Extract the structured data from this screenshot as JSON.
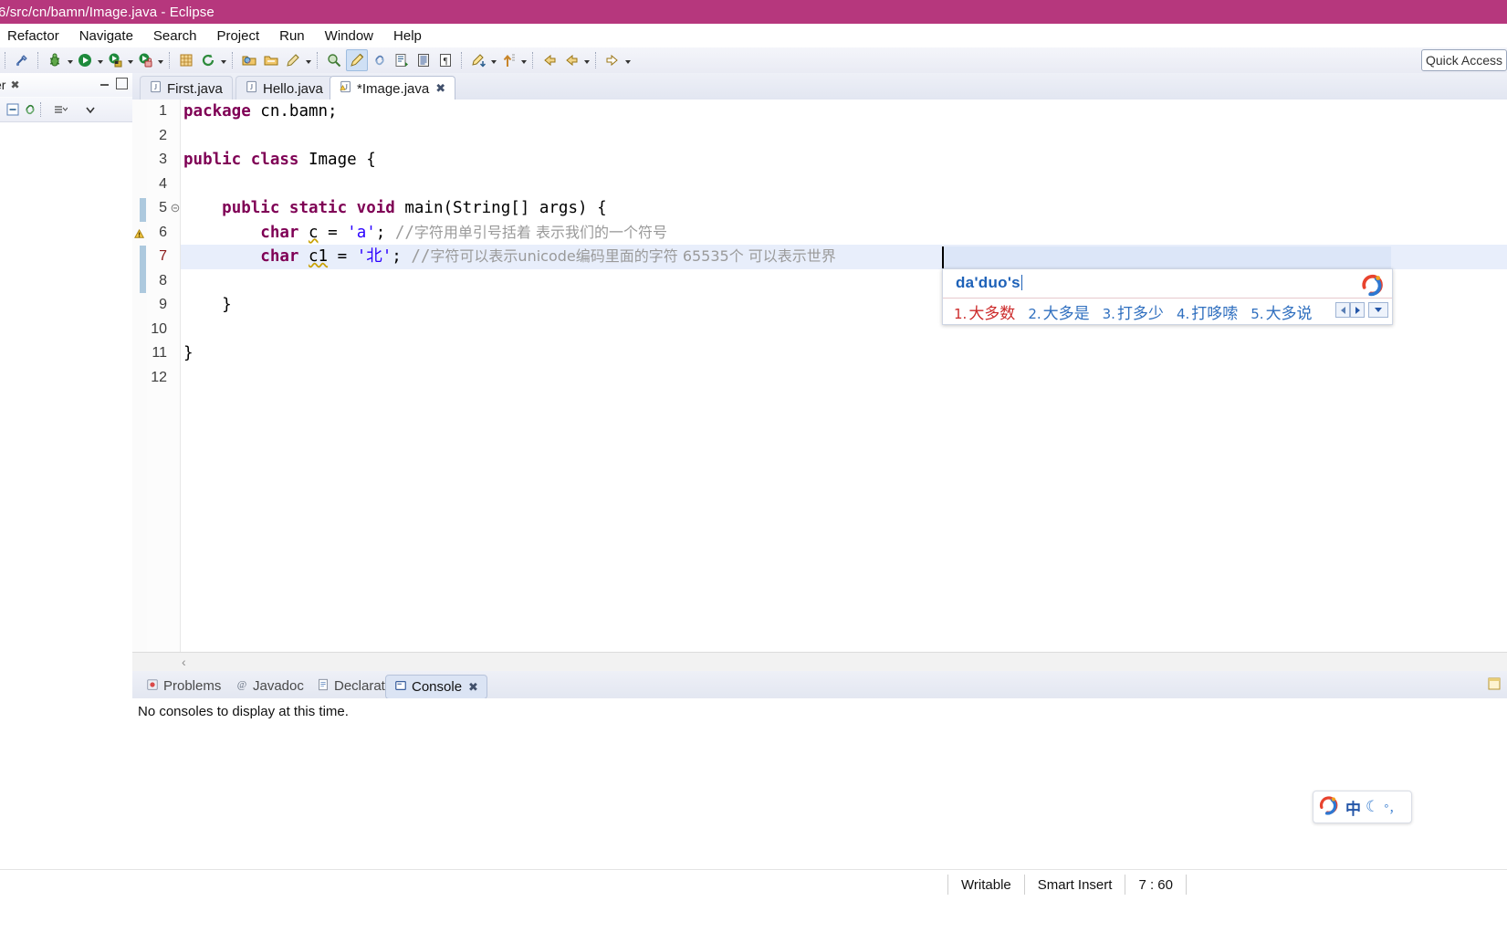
{
  "window": {
    "title": "6/src/cn/bamn/Image.java - Eclipse",
    "title_bar_color": "#b6377d"
  },
  "menu": {
    "items": [
      {
        "label": "Refactor"
      },
      {
        "label": "Navigate"
      },
      {
        "label": "Search"
      },
      {
        "label": "Project"
      },
      {
        "label": "Run"
      },
      {
        "label": "Window"
      },
      {
        "label": "Help"
      }
    ]
  },
  "toolbar": {
    "quick_access_placeholder": "Quick Access",
    "buttons": [
      {
        "name": "new-wizard-icon"
      },
      {
        "name": "debug-icon"
      },
      {
        "name": "run-icon"
      },
      {
        "name": "run-external-tools-icon"
      },
      {
        "name": "coverage-icon"
      },
      {
        "name": "new-java-package-icon"
      },
      {
        "name": "refresh-icon"
      },
      {
        "name": "open-type-icon"
      },
      {
        "name": "open-task-icon"
      },
      {
        "name": "edit-icon"
      },
      {
        "name": "search-icon"
      },
      {
        "name": "pencil-highlight-icon"
      },
      {
        "name": "link-icon"
      },
      {
        "name": "next-annotation-icon"
      },
      {
        "name": "book-icon"
      },
      {
        "name": "paragraph-icon"
      },
      {
        "name": "next-edit-icon"
      },
      {
        "name": "up-arrow-icon"
      },
      {
        "name": "back-icon"
      },
      {
        "name": "back2-icon"
      },
      {
        "name": "forward-icon"
      }
    ]
  },
  "left_view": {
    "tab_label": "er",
    "close_glyph": "✖"
  },
  "editor": {
    "tabs": [
      {
        "label": "First.java",
        "active": false,
        "dirty": false,
        "icon": "java-file-icon"
      },
      {
        "label": "Hello.java",
        "active": false,
        "dirty": false,
        "icon": "java-file-icon"
      },
      {
        "label": "*Image.java",
        "active": true,
        "dirty": true,
        "icon": "java-file-warning-icon"
      }
    ],
    "close_glyph": "✖",
    "lines": [
      {
        "num": "1",
        "fold": "",
        "highlight": false,
        "warning": false,
        "segments": [
          {
            "t": "package",
            "c": "kw"
          },
          {
            "t": " cn.bamn;",
            "c": "plain"
          }
        ]
      },
      {
        "num": "2",
        "fold": "",
        "highlight": false,
        "warning": false,
        "segments": []
      },
      {
        "num": "3",
        "fold": "",
        "highlight": false,
        "warning": false,
        "segments": [
          {
            "t": "public class",
            "c": "kw"
          },
          {
            "t": " Image {",
            "c": "plain"
          }
        ]
      },
      {
        "num": "4",
        "fold": "",
        "highlight": false,
        "warning": false,
        "segments": []
      },
      {
        "num": "5",
        "fold": "⊝",
        "highlight": false,
        "warning": false,
        "segments": [
          {
            "t": "    ",
            "c": "plain"
          },
          {
            "t": "public static void",
            "c": "kw"
          },
          {
            "t": " main(String[] args) {",
            "c": "plain"
          }
        ]
      },
      {
        "num": "6",
        "fold": "",
        "highlight": false,
        "warning": true,
        "segments": [
          {
            "t": "        ",
            "c": "plain"
          },
          {
            "t": "char",
            "c": "kw"
          },
          {
            "t": " ",
            "c": "plain"
          },
          {
            "t": "c",
            "c": "sq"
          },
          {
            "t": " = ",
            "c": "plain"
          },
          {
            "t": "'a'",
            "c": "str"
          },
          {
            "t": "; ",
            "c": "plain"
          },
          {
            "t": "//",
            "c": "cmt"
          },
          {
            "t": "字符用单引号括着 表示我们的一个符号",
            "c": "cmtcn"
          }
        ]
      },
      {
        "num": "7",
        "fold": "",
        "highlight": true,
        "warning": false,
        "segments": [
          {
            "t": "        ",
            "c": "plain"
          },
          {
            "t": "char",
            "c": "kw"
          },
          {
            "t": " ",
            "c": "plain"
          },
          {
            "t": "c1",
            "c": "sq"
          },
          {
            "t": " = ",
            "c": "plain"
          },
          {
            "t": "'北'",
            "c": "str"
          },
          {
            "t": "; ",
            "c": "plain"
          },
          {
            "t": "//",
            "c": "cmt"
          },
          {
            "t": "字符可以表示unicode编码里面的字符 65535个 可以表示世界",
            "c": "cmtcn"
          }
        ]
      },
      {
        "num": "8",
        "fold": "",
        "highlight": false,
        "warning": false,
        "segments": []
      },
      {
        "num": "9",
        "fold": "",
        "highlight": false,
        "warning": false,
        "segments": [
          {
            "t": "    }",
            "c": "plain"
          }
        ]
      },
      {
        "num": "10",
        "fold": "",
        "highlight": false,
        "warning": false,
        "segments": []
      },
      {
        "num": "11",
        "fold": "",
        "highlight": false,
        "warning": false,
        "segments": [
          {
            "t": "}",
            "c": "plain"
          }
        ]
      },
      {
        "num": "12",
        "fold": "",
        "highlight": false,
        "warning": false,
        "segments": []
      }
    ],
    "hscroll_left_glyph": "‹"
  },
  "bottom_panel": {
    "tabs": [
      {
        "label": "Problems",
        "active": false,
        "icon": "problems-icon"
      },
      {
        "label": "Javadoc",
        "active": false,
        "icon": "javadoc-icon"
      },
      {
        "label": "Declaration",
        "active": false,
        "icon": "declaration-icon"
      },
      {
        "label": "Console",
        "active": true,
        "icon": "console-icon"
      }
    ],
    "close_glyph": "✖",
    "console_message": "No consoles to display at this time."
  },
  "status_bar": {
    "writable": "Writable",
    "insert_mode": "Smart Insert",
    "cursor_position": "7 : 60"
  },
  "ime": {
    "composition": "da'duo's",
    "candidates": [
      {
        "index": "1.",
        "text": "大多数"
      },
      {
        "index": "2.",
        "text": "大多是"
      },
      {
        "index": "3.",
        "text": "打多少"
      },
      {
        "index": "4.",
        "text": "打哆嗦"
      },
      {
        "index": "5.",
        "text": "大多说"
      }
    ],
    "brand": "sogou-logo-icon",
    "prev_page": "◀",
    "next_page": "▶",
    "expand": "▼"
  },
  "sogou_toolbar": {
    "logo": "sogou-logo-icon",
    "mode_label": "中",
    "moon": "☾",
    "punctuation": "°，"
  }
}
